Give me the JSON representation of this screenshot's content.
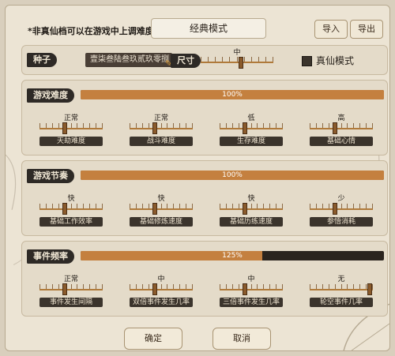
{
  "header": {
    "note": "*非真仙档可以在游戏中上调难度",
    "mode": "经典模式",
    "import_label": "导入",
    "export_label": "导出"
  },
  "seed": {
    "tag": "种子",
    "value": "壹柒叁陆叁玖贰玖零捌",
    "size_tag": "尺寸",
    "size_level": "中",
    "size_fraction": 0.55,
    "truemode_label": "真仙模式",
    "truemode_checked": false
  },
  "difficulty": {
    "tag": "游戏难度",
    "overall_text": "100%",
    "overall_fraction": 1.0,
    "items": [
      {
        "label": "天劫难度",
        "level": "正常",
        "fraction": 0.4
      },
      {
        "label": "战斗难度",
        "level": "正常",
        "fraction": 0.4
      },
      {
        "label": "生存难度",
        "level": "低",
        "fraction": 0.4
      },
      {
        "label": "基础心情",
        "level": "高",
        "fraction": 0.4
      }
    ]
  },
  "rhythm": {
    "tag": "游戏节奏",
    "overall_text": "100%",
    "overall_fraction": 1.0,
    "items": [
      {
        "label": "基础工作效率",
        "level": "快",
        "fraction": 0.4
      },
      {
        "label": "基础修炼速度",
        "level": "快",
        "fraction": 0.4
      },
      {
        "label": "基础历练速度",
        "level": "快",
        "fraction": 0.4
      },
      {
        "label": "参悟消耗",
        "level": "少",
        "fraction": 0.4
      }
    ]
  },
  "events": {
    "tag": "事件频率",
    "overall_text": "125%",
    "overall_fraction": 0.6,
    "items": [
      {
        "label": "事件发生间隔",
        "level": "正常",
        "fraction": 0.4
      },
      {
        "label": "双倍事件发生几率",
        "level": "中",
        "fraction": 0.4
      },
      {
        "label": "三倍事件发生几率",
        "level": "中",
        "fraction": 0.4
      },
      {
        "label": "轮空事件几率",
        "level": "无",
        "fraction": 0.95
      }
    ]
  },
  "footer": {
    "confirm_label": "确定",
    "cancel_label": "取消"
  },
  "colors": {
    "accent": "#c4803f",
    "dark": "#2a241e",
    "panel": "#e4dbc9"
  }
}
